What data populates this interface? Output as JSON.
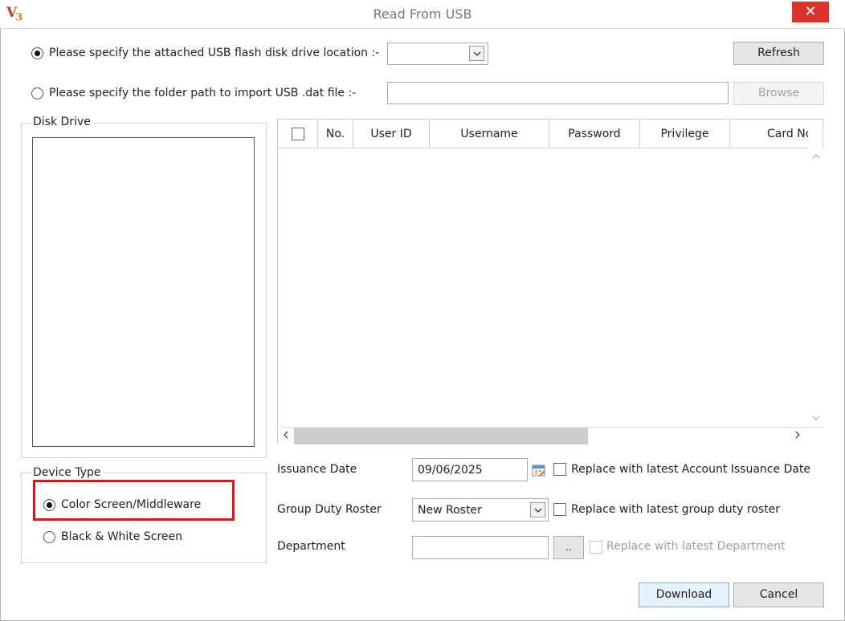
{
  "window": {
    "logo_main": "V",
    "logo_sub": "3",
    "title": "Read From USB",
    "close_glyph": "✕"
  },
  "source": {
    "usb_option_label": "Please specify the attached USB flash disk drive location :-",
    "usb_option_selected": true,
    "usb_drive_value": "",
    "refresh_label": "Refresh",
    "folder_option_label": "Please specify the folder path to import USB .dat file :-",
    "folder_option_selected": false,
    "folder_path_value": "",
    "browse_label": "Browse"
  },
  "disk_drive": {
    "legend": "Disk Drive"
  },
  "grid": {
    "columns": [
      "No.",
      "User ID",
      "Username",
      "Password",
      "Privilege",
      "Card No"
    ],
    "rows": []
  },
  "device_type": {
    "legend": "Device Type",
    "options": [
      {
        "label": "Color Screen/Middleware",
        "selected": true
      },
      {
        "label": "Black & White Screen",
        "selected": false
      }
    ],
    "highlight_color": "#e0141b"
  },
  "form": {
    "issuance_date_label": "Issuance Date",
    "issuance_date_value": "09/06/2025",
    "replace_issuance_label": "Replace with latest Account Issuance Date",
    "group_roster_label": "Group Duty Roster",
    "group_roster_value": "New Roster",
    "replace_roster_label": "Replace with latest group duty roster",
    "department_label": "Department",
    "department_value": "",
    "department_picker_label": "..",
    "replace_department_label": "Replace with latest Department"
  },
  "actions": {
    "download_label": "Download",
    "cancel_label": "Cancel"
  },
  "icons": {
    "calendar": "calendar-icon",
    "dropdown": "chevron-down-icon",
    "close": "close-icon"
  }
}
